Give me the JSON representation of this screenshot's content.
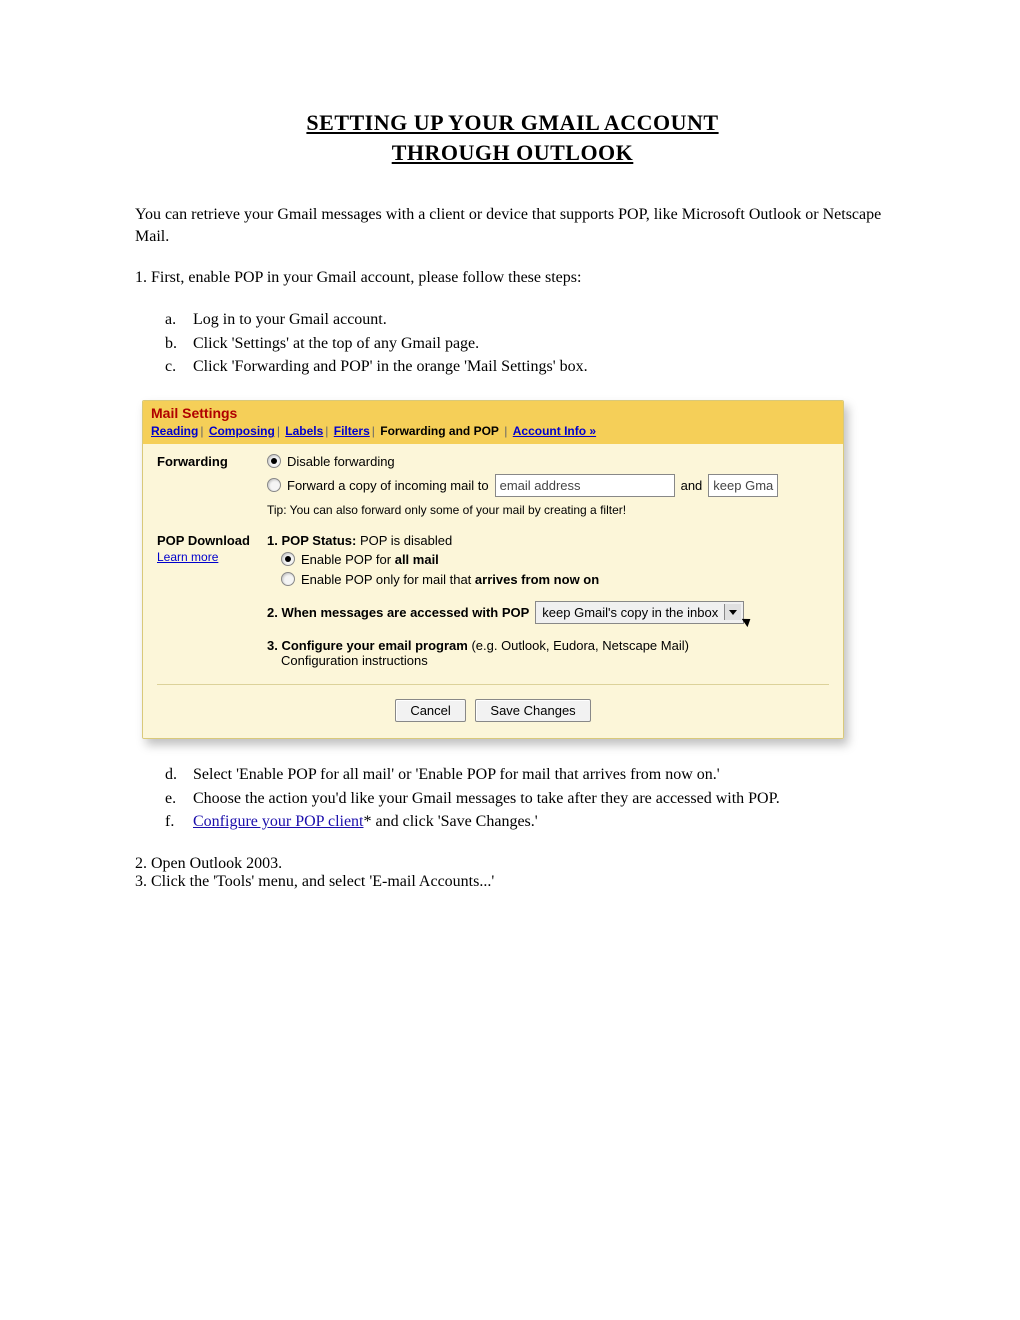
{
  "title_line1": "SETTING UP YOUR GMAIL ACCOUNT",
  "title_line2": "THROUGH OUTLOOK",
  "intro": "You can retrieve your Gmail messages with a client or device that supports POP, like Microsoft Outlook or Netscape Mail.",
  "step1": "1. First, enable POP in your Gmail account, please follow these steps:",
  "sub_a": {
    "letter": "a.",
    "text": "Log in to your Gmail account."
  },
  "sub_b": {
    "letter": "b.",
    "text": "Click 'Settings' at the top of any Gmail page."
  },
  "sub_c": {
    "letter": "c.",
    "text": "Click 'Forwarding and POP' in the orange 'Mail Settings' box."
  },
  "sub_d": {
    "letter": "d.",
    "text": "Select 'Enable POP for all mail' or 'Enable POP for mail that arrives from now on.'"
  },
  "sub_e": {
    "letter": "e.",
    "text": "Choose the action you'd like your Gmail messages to take after they are accessed with POP."
  },
  "sub_f": {
    "letter": "f.",
    "link": "Configure your POP client",
    "after": "* and click 'Save Changes.'"
  },
  "step2": "2.  Open Outlook 2003.",
  "step3": "3.  Click the 'Tools' menu, and select 'E-mail Accounts...'",
  "panel": {
    "header_title": "Mail Settings",
    "tabs": {
      "reading": "Reading",
      "composing": "Composing",
      "labels": "Labels",
      "filters": "Filters",
      "forwarding": "Forwarding and POP",
      "account": "Account Info »"
    },
    "forwarding": {
      "label": "Forwarding",
      "opt_disable": "Disable forwarding",
      "opt_forward_pre": "Forward a copy of incoming mail to",
      "email_placeholder": "email address",
      "and": "and",
      "keep_select": "keep Gma",
      "tip_pre": "Tip: You can also forward only some of your mail by ",
      "tip_link": "creating a filter!"
    },
    "pop": {
      "label": "POP Download",
      "learn": "Learn more",
      "status_label": "1. POP Status:",
      "status_val": " POP is disabled",
      "enable_all_pre": "Enable POP for ",
      "enable_all_bold": "all mail",
      "enable_new_pre": "Enable POP only for mail that ",
      "enable_new_bold": "arrives from now on",
      "q2": "2. When messages are accessed with POP",
      "q2_select": "keep Gmail's copy in the inbox",
      "q3_bold": "3. Configure your email program",
      "q3_rest": " (e.g. Outlook, Eudora, Netscape Mail)",
      "q3_link": "Configuration instructions"
    },
    "buttons": {
      "cancel": "Cancel",
      "save": "Save Changes"
    }
  }
}
